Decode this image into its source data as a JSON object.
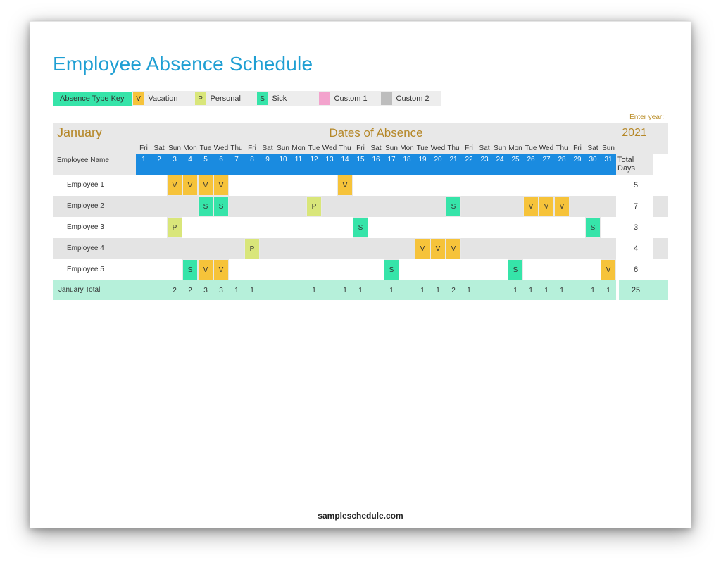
{
  "title": "Employee Absence Schedule",
  "legend_label": "Absence Type Key",
  "legend_items": [
    {
      "code": "V",
      "text": "Vacation",
      "class": "sw-V"
    },
    {
      "code": "P",
      "text": "Personal",
      "class": "sw-P"
    },
    {
      "code": "S",
      "text": "Sick",
      "class": "sw-S"
    },
    {
      "code": "",
      "text": "Custom 1",
      "class": "sw-C1"
    },
    {
      "code": "",
      "text": "Custom 2",
      "class": "sw-C2"
    }
  ],
  "enter_year_label": "Enter year:",
  "month": "January",
  "dates_of_absence": "Dates of Absence",
  "year": "2021",
  "employee_name_label": "Employee Name",
  "total_days_label": "Total Days",
  "weekdays": [
    "Fri",
    "Sat",
    "Sun",
    "Mon",
    "Tue",
    "Wed",
    "Thu",
    "Fri",
    "Sat",
    "Sun",
    "Mon",
    "Tue",
    "Wed",
    "Thu",
    "Fri",
    "Sat",
    "Sun",
    "Mon",
    "Tue",
    "Wed",
    "Thu",
    "Fri",
    "Sat",
    "Sun",
    "Mon",
    "Tue",
    "Wed",
    "Thu",
    "Fri",
    "Sat",
    "Sun"
  ],
  "days": [
    "1",
    "2",
    "3",
    "4",
    "5",
    "6",
    "7",
    "8",
    "9",
    "10",
    "11",
    "12",
    "13",
    "14",
    "15",
    "16",
    "17",
    "18",
    "19",
    "20",
    "21",
    "22",
    "23",
    "24",
    "25",
    "26",
    "27",
    "28",
    "29",
    "30",
    "31"
  ],
  "employees": [
    {
      "name": "Employee 1",
      "absences": {
        "3": "V",
        "4": "V",
        "5": "V",
        "6": "V",
        "14": "V"
      },
      "total": "5"
    },
    {
      "name": "Employee 2",
      "absences": {
        "5": "S",
        "6": "S",
        "12": "P",
        "21": "S",
        "26": "V",
        "27": "V",
        "28": "V"
      },
      "total": "7"
    },
    {
      "name": "Employee 3",
      "absences": {
        "3": "P",
        "15": "S",
        "30": "S"
      },
      "total": "3"
    },
    {
      "name": "Employee 4",
      "absences": {
        "8": "P",
        "19": "V",
        "20": "V",
        "21": "V"
      },
      "total": "4"
    },
    {
      "name": "Employee 5",
      "absences": {
        "4": "S",
        "5": "V",
        "6": "V",
        "17": "S",
        "25": "S",
        "31": "V"
      },
      "total": "6"
    }
  ],
  "totals_label": "January Total",
  "daily_totals": [
    "",
    "",
    "2",
    "2",
    "3",
    "3",
    "1",
    "1",
    "",
    "",
    "",
    "1",
    "",
    "1",
    "1",
    "",
    "1",
    "",
    "1",
    "1",
    "2",
    "1",
    "",
    "",
    "1",
    "1",
    "1",
    "1",
    "",
    "1",
    "1"
  ],
  "grand_total": "25",
  "footer": "sampleschedule.com",
  "chart_data": {
    "type": "table",
    "title": "Employee Absence Schedule — January 2021",
    "columns": "days 1–31",
    "legend": {
      "V": "Vacation",
      "P": "Personal",
      "S": "Sick"
    },
    "rows": [
      {
        "employee": "Employee 1",
        "cells": {
          "3": "V",
          "4": "V",
          "5": "V",
          "6": "V",
          "14": "V"
        },
        "total": 5
      },
      {
        "employee": "Employee 2",
        "cells": {
          "5": "S",
          "6": "S",
          "12": "P",
          "21": "S",
          "26": "V",
          "27": "V",
          "28": "V"
        },
        "total": 7
      },
      {
        "employee": "Employee 3",
        "cells": {
          "3": "P",
          "15": "S",
          "30": "S"
        },
        "total": 3
      },
      {
        "employee": "Employee 4",
        "cells": {
          "8": "P",
          "19": "V",
          "20": "V",
          "21": "V"
        },
        "total": 4
      },
      {
        "employee": "Employee 5",
        "cells": {
          "4": "S",
          "5": "V",
          "6": "V",
          "17": "S",
          "25": "S",
          "31": "V"
        },
        "total": 6
      }
    ],
    "daily_totals": [
      0,
      0,
      2,
      2,
      3,
      3,
      1,
      1,
      0,
      0,
      0,
      1,
      0,
      1,
      1,
      0,
      1,
      0,
      1,
      1,
      2,
      1,
      0,
      0,
      1,
      1,
      1,
      1,
      0,
      1,
      1
    ],
    "grand_total": 25
  }
}
